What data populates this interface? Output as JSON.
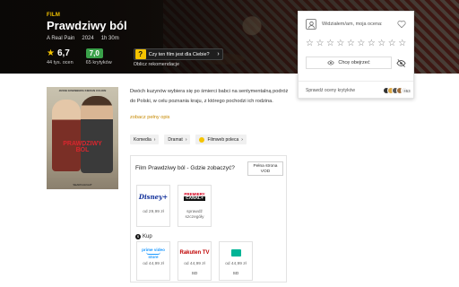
{
  "hero": {
    "genre": "FILM",
    "title": "Prawdziwy ból",
    "original_title": "A Real Pain",
    "year": "2024",
    "duration": "1h 30m",
    "user_score": "6,7",
    "user_votes": "44 tys. ocen",
    "critic_score": "7,0",
    "critic_votes": "65 krytyków",
    "reco_question_mark": "?",
    "reco_question": "Czy ten film jest dla Ciebie?",
    "reco_sub": "Oblicz rekomendacje"
  },
  "rating_card": {
    "prompt": "Widziałem/am, moja ocena:",
    "stars_count": 10,
    "want_to_see": "Chcę obejrzeć",
    "critics_label": "Sprawdź oceny krytyków",
    "critics_more": "+63"
  },
  "poster": {
    "top_text": "JESSE EISENBERG   KIERAN CULKIN",
    "title_line1": "PRAWDZIWY",
    "title_line2": "BÓL",
    "bottom_text": "SEARCHLIGHT"
  },
  "description": {
    "text": "Dwóch kuzynów wybiera się po śmierci babci na sentymentalną podróż do Polski, w celu poznania kraju, z którego pochodzi ich rodzina.",
    "more": "zobacz pełny opis"
  },
  "tags": [
    {
      "label": "Komedia"
    },
    {
      "label": "Dramat"
    },
    {
      "label": "Filmweb poleca"
    }
  ],
  "watch": {
    "title": "Film Prawdziwy ból - Gdzie zobaczyć?",
    "vod_btn_line1": "Pełna strona",
    "vod_btn_line2": "VOD",
    "subscription": [
      {
        "logo": "Disney+",
        "price": "od 29,99 zł"
      },
      {
        "logo_line1": "PREMIERY",
        "logo_line2": "CANAL+",
        "price_line1": "sprawdź",
        "price_line2": "szczegóły"
      }
    ],
    "buy_coin": "$",
    "buy_label": "Kup",
    "buy": [
      {
        "logo_line1": "prime video",
        "logo_line2": "store",
        "price": "od 44,99 zł",
        "quality": ""
      },
      {
        "logo": "Rakuten TV",
        "price": "od 44,99 zł",
        "quality": "SD"
      },
      {
        "logo": "",
        "price": "od 44,99 zł",
        "quality": "SD"
      }
    ]
  },
  "colors": {
    "accent": "#f5c400",
    "critic_green": "#3aa14a",
    "link": "#c68900"
  }
}
